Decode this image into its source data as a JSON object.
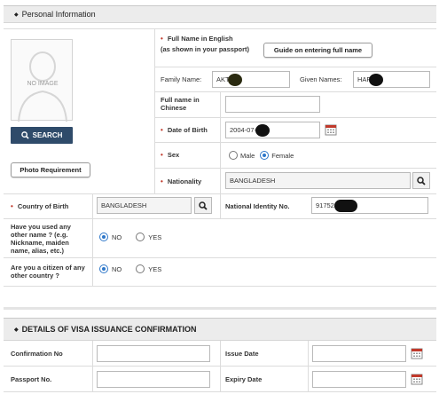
{
  "personal": {
    "title": "Personal Information",
    "photo_placeholder": "NO IMAGE",
    "search_label": "SEARCH",
    "photo_req_label": "Photo Requirement",
    "fullname_label": "Full Name in English",
    "fullname_sub": "(as shown in your passport)",
    "guide_label": "Guide on entering full name",
    "family_label": "Family Name:",
    "family_value": "AKT",
    "given_label": "Given Names:",
    "given_value": "HAF",
    "chinese_label": "Full name in Chinese",
    "chinese_value": "",
    "dob_label": "Date of Birth",
    "dob_value": "2004-07-",
    "sex_label": "Sex",
    "male_label": "Male",
    "female_label": "Female",
    "sex_selected": "Female",
    "nationality_label": "Nationality",
    "nationality_value": "BANGLADESH",
    "country_birth_label": "Country of Birth",
    "country_birth_value": "BANGLADESH",
    "nid_label": "National Identity No.",
    "nid_value": "917524",
    "other_name_q": "Have you used any other name ? (e.g. Nickname, maiden name, alias, etc.)",
    "citizen_q": "Are you a citizen of any other country ?",
    "no_label": "NO",
    "yes_label": "YES",
    "other_name_selected": "NO",
    "citizen_selected": "NO"
  },
  "visa": {
    "title": "DETAILS OF VISA ISSUANCE CONFIRMATION",
    "confirmation_label": "Confirmation No",
    "issue_label": "Issue Date",
    "passport_label": "Passport No.",
    "expiry_label": "Expiry Date",
    "confirmation_value": "",
    "issue_value": "",
    "passport_value": "",
    "expiry_value": ""
  },
  "colors": {
    "required": "#c0392b",
    "search_button": "#2f4b6a",
    "radio_selected": "#2e77c9"
  },
  "icons": {
    "search": "magnifier-icon",
    "calendar": "calendar-icon",
    "avatar": "person-silhouette-icon"
  }
}
